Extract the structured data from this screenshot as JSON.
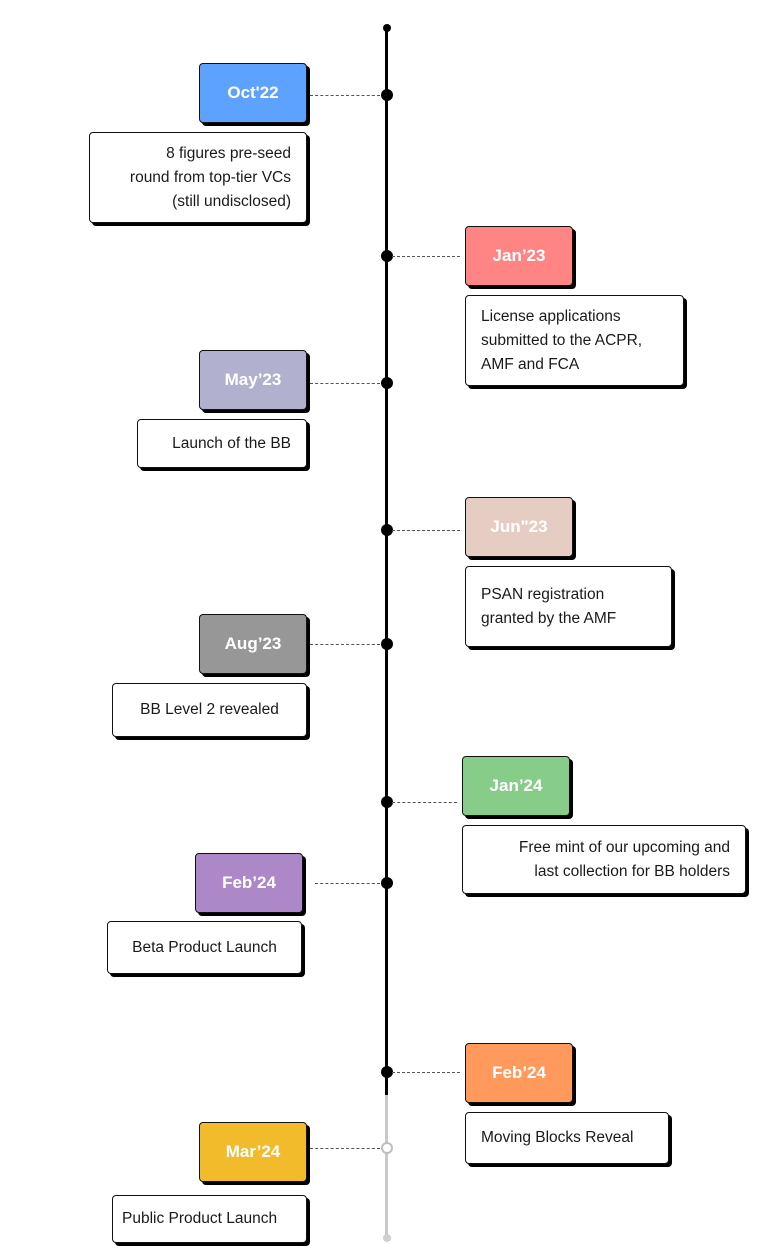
{
  "timeline": {
    "events": [
      {
        "date": "Oct'22",
        "color": "#5ea2ff",
        "description": "8 figures pre-seed\nround from top-tier VCs\n(still undisclosed)",
        "status": "completed"
      },
      {
        "date": "Jan’23",
        "color": "#ff8585",
        "description": "License applications\nsubmitted to the ACPR,\nAMF and FCA",
        "status": "completed"
      },
      {
        "date": "May’23",
        "color": "#b1b0cf",
        "description": "Launch of the BB",
        "status": "completed"
      },
      {
        "date": "Jun\"23",
        "color": "#e6cdc3",
        "description": "PSAN  registration\ngranted by the AMF",
        "status": "completed"
      },
      {
        "date": "Aug’23",
        "color": "#979797",
        "description": "BB Level 2 revealed",
        "status": "completed"
      },
      {
        "date": "Jan’24",
        "color": "#88cc8a",
        "description": "Free mint of our upcoming and\nlast collection for BB holders",
        "status": "completed"
      },
      {
        "date": "Feb’24",
        "color": "#ad88c9",
        "description": "Beta Product Launch",
        "status": "completed"
      },
      {
        "date": "Feb’24",
        "color": "#ff9a5c",
        "description": "Moving Blocks Reveal",
        "status": "completed"
      },
      {
        "date": "Mar’24",
        "color": "#f2bb2c",
        "description": "Public Product Launch",
        "status": "upcoming"
      }
    ]
  }
}
